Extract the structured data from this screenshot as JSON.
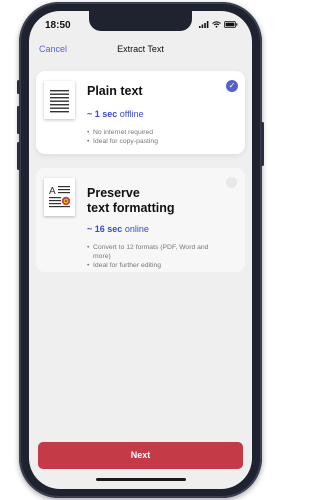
{
  "status": {
    "time": "18:50"
  },
  "nav": {
    "cancel": "Cancel",
    "title": "Extract Text"
  },
  "options": [
    {
      "title": "Plain text",
      "duration": "~ 1 sec",
      "mode": "offline",
      "bullets": [
        "No internet required",
        "Ideal for copy-pasting"
      ],
      "selected": true
    },
    {
      "title_line1": "Preserve",
      "title_line2": "text formatting",
      "duration": "~ 16 sec",
      "mode": "online",
      "bullets": [
        "Convert to 12 formats (PDF, Word and more)",
        "Ideal for further editing"
      ],
      "selected": false
    }
  ],
  "footer": {
    "next": "Next"
  },
  "colors": {
    "accent": "#5b63d3",
    "primary_button": "#c53a47",
    "link_blue": "#3a4bc9"
  }
}
